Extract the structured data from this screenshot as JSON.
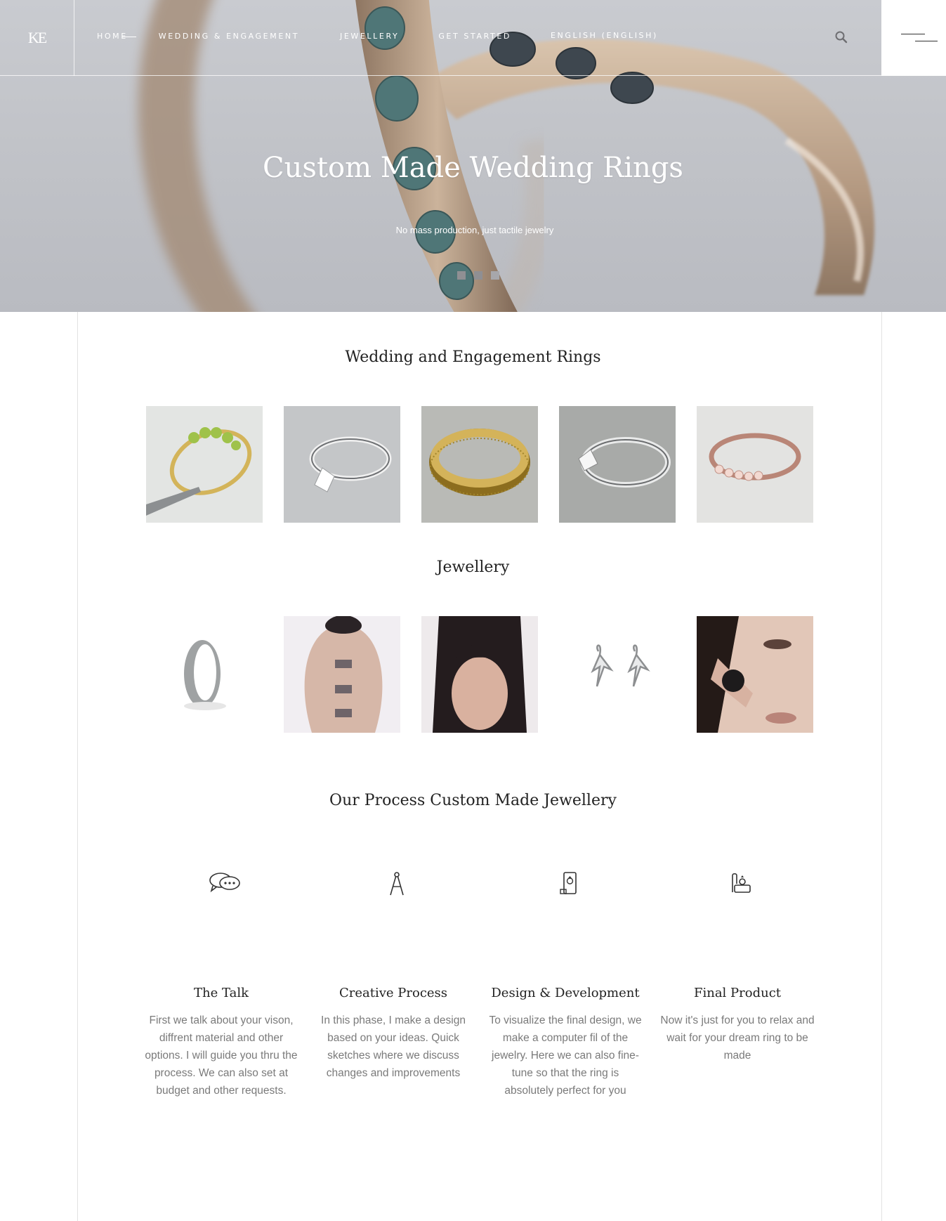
{
  "header": {
    "logo": "KE",
    "nav": [
      {
        "label": "Home"
      },
      {
        "label": "Wedding & Engagement"
      },
      {
        "label": "Jewellery"
      },
      {
        "label": "Get Started"
      },
      {
        "label": "English (English)"
      }
    ]
  },
  "hero": {
    "title": "Custom Made Wedding Rings",
    "subtitle": "No mass production, just tactile jewelry",
    "slides": 3,
    "active_slide": 3
  },
  "sections": {
    "wedding_title": "Wedding and Engagement Rings",
    "jewellery_title": "Jewellery",
    "process_title": "Our Process Custom Made Jewellery"
  },
  "process": [
    {
      "icon": "speech-bubbles-icon",
      "title": "The Talk",
      "text": "First we talk about your vison, diffrent material and other options. I will guide you thru the process. We can also set at budget and other requests."
    },
    {
      "icon": "compass-icon",
      "title": "Creative Process",
      "text": "In this phase, I make a design based on your ideas. Quick sketches where we discuss changes and improvements"
    },
    {
      "icon": "tablet-design-icon",
      "title": "Design & Development",
      "text": "To visualize the final design, we make a computer fil of the jewelry. Here we can also fine-tune so that the ring is absolutely perfect for you"
    },
    {
      "icon": "ring-box-icon",
      "title": "Final Product",
      "text": "Now it's just for you to relax and wait for your dream ring to be made"
    }
  ],
  "colors": {
    "hero_bg": "#c4c6cb",
    "text_dark": "#222222",
    "text_muted": "#7a7a7a",
    "border": "#e2e2e2"
  }
}
